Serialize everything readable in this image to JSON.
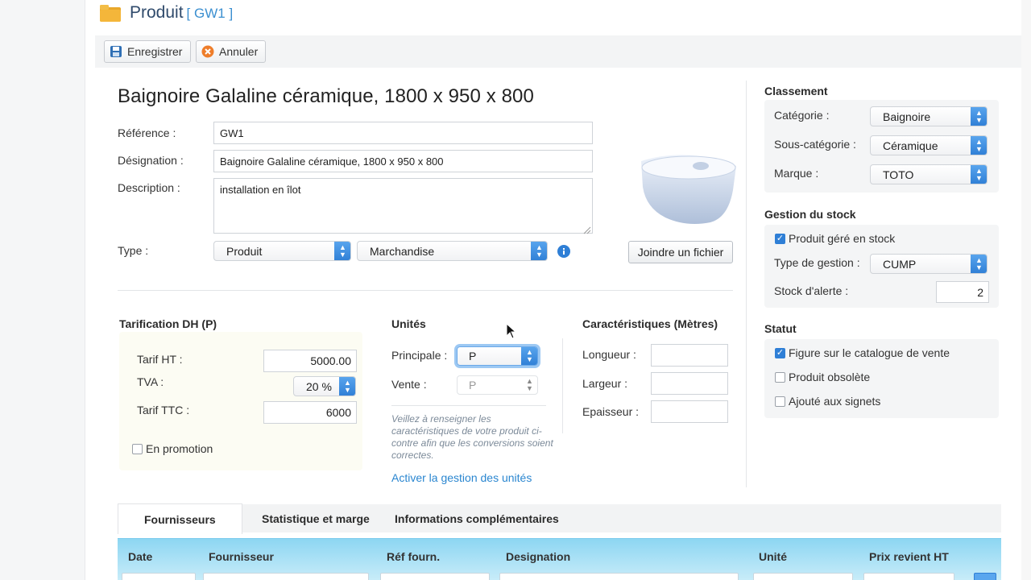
{
  "header": {
    "title": "Produit",
    "code": "[ GW1 ]",
    "icon": "folder-icon"
  },
  "toolbar": {
    "save_label": "Enregistrer",
    "cancel_label": "Annuler"
  },
  "product": {
    "heading": "Baignoire Galaline céramique, 1800 x 950 x 800",
    "reference_label": "Référence :",
    "reference_value": "GW1",
    "designation_label": "Désignation :",
    "designation_value": "Baignoire Galaline céramique, 1800 x 950 x 800",
    "description_label": "Description :",
    "description_value": "installation en îlot",
    "type_label": "Type :",
    "type_value": "Produit",
    "subtype_value": "Marchandise",
    "attach_button": "Joindre un fichier"
  },
  "pricing": {
    "title": "Tarification DH (P)",
    "ht_label": "Tarif HT :",
    "ht_value": "5000.00",
    "tva_label": "TVA :",
    "tva_value": "20 %",
    "ttc_label": "Tarif TTC :",
    "ttc_value": "6000",
    "promo_label": "En promotion",
    "promo_checked": false
  },
  "units": {
    "title": "Unités",
    "principal_label": "Principale :",
    "principal_value": "P",
    "vente_label": "Vente :",
    "vente_value": "P",
    "hint": "Veillez à renseigner les caractéristiques de votre produit ci-contre afin que les conversions soient correctes.",
    "activate_link": "Activer la gestion des unités"
  },
  "characteristics": {
    "title": "Caractéristiques (Mètres)",
    "longueur_label": "Longueur :",
    "largeur_label": "Largeur :",
    "epaisseur_label": "Epaisseur :"
  },
  "classement": {
    "title": "Classement",
    "categorie_label": "Catégorie :",
    "categorie_value": "Baignoire",
    "souscat_label": "Sous-catégorie :",
    "souscat_value": "Céramique",
    "marque_label": "Marque :",
    "marque_value": "TOTO"
  },
  "stock": {
    "title": "Gestion du stock",
    "managed_label": "Produit géré en stock",
    "managed_checked": true,
    "type_label": "Type de gestion :",
    "type_value": "CUMP",
    "alert_label": "Stock d'alerte :",
    "alert_value": "2"
  },
  "statut": {
    "title": "Statut",
    "catalogue_label": "Figure sur le catalogue de vente",
    "catalogue_checked": true,
    "obsolete_label": "Produit obsolète",
    "obsolete_checked": false,
    "signets_label": "Ajouté aux signets",
    "signets_checked": false
  },
  "tabs": [
    {
      "label": "Fournisseurs",
      "active": true
    },
    {
      "label": "Statistique et marge",
      "active": false
    },
    {
      "label": "Informations complémentaires",
      "active": false
    }
  ],
  "suppliers_table": {
    "columns": [
      "Date",
      "Fournisseur",
      "Réf fourn.",
      "Designation",
      "Unité",
      "Prix revient HT"
    ]
  },
  "colors": {
    "accent": "#2f7fd6",
    "title": "#2f4a6b",
    "link": "#2a86d0",
    "grid_header": "#8dd6f2"
  }
}
